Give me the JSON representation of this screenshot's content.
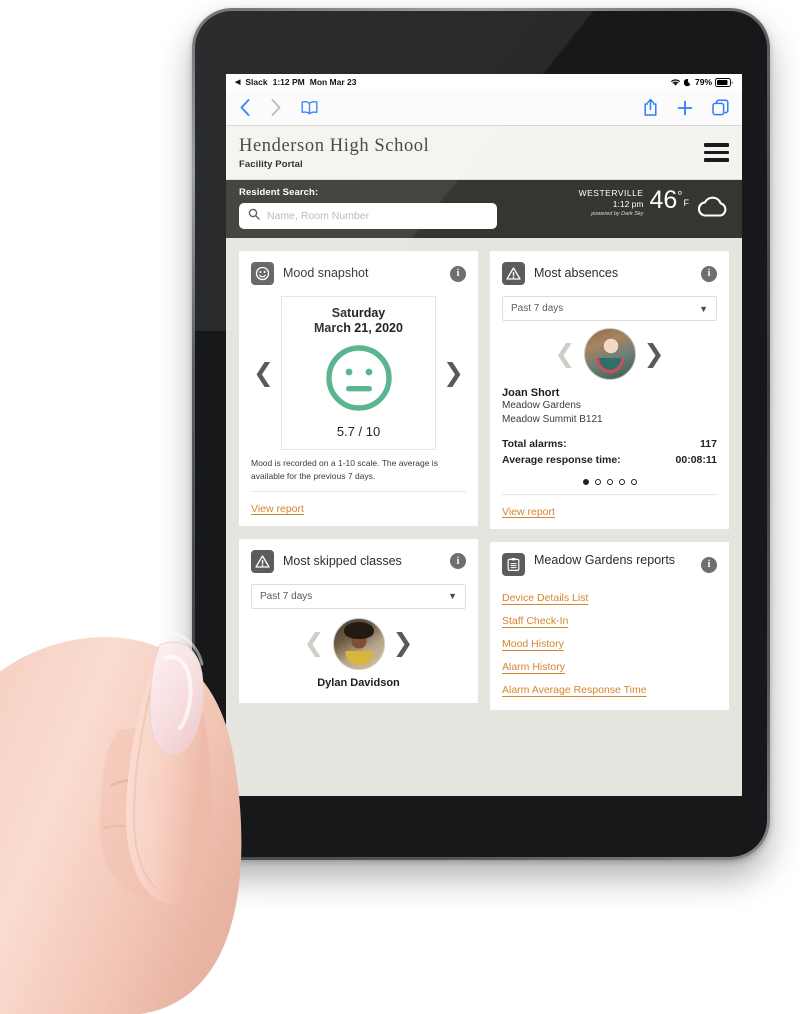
{
  "status_bar": {
    "back_app": "Slack",
    "time": "1:12 PM",
    "date": "Mon Mar 23",
    "battery": "79%",
    "wifi_icon": "wifi-icon",
    "dnd_icon": "crescent-moon-icon",
    "battery_icon": "battery-icon"
  },
  "browser_toolbar": {
    "back_icon": "chevron-left-icon",
    "forward_icon": "chevron-right-icon",
    "bookmarks_icon": "book-icon",
    "share_icon": "share-icon",
    "new_tab_icon": "plus-icon",
    "tabs_icon": "tabs-icon"
  },
  "app_header": {
    "school_name": "Henderson High School",
    "subtitle": "Facility Portal",
    "menu_icon": "hamburger-menu-icon"
  },
  "search": {
    "label": "Resident Search:",
    "placeholder": "Name, Room Number",
    "value": "",
    "icon": "search-icon"
  },
  "weather": {
    "city": "WESTERVILLE",
    "time": "1:12 pm",
    "powered_by": "powered by Dark Sky",
    "temperature": "46",
    "degree_symbol": "°",
    "unit": "F",
    "condition_icon": "cloud-icon"
  },
  "cards": {
    "mood": {
      "title": "Mood snapshot",
      "icon": "smiley-face-icon",
      "info_icon": "info-icon",
      "prev_icon": "chevron-left-icon",
      "next_icon": "chevron-right-icon",
      "day": "Saturday",
      "date": "March 21, 2020",
      "face_icon": "neutral-face-icon",
      "score": "5.7 / 10",
      "note": "Mood is recorded on a 1-10 scale. The average is available for the previous 7 days.",
      "view_report": "View report",
      "accent_color": "#5bb68f"
    },
    "absences": {
      "title": "Most absences",
      "icon": "warning-triangle-icon",
      "info_icon": "info-icon",
      "range_value": "Past 7 days",
      "range_caret": "chevron-down-icon",
      "prev_icon": "chevron-left-icon",
      "next_icon": "chevron-right-icon",
      "person_name": "Joan Short",
      "person_location_1": "Meadow Gardens",
      "person_location_2": "Meadow Summit B121",
      "stats": [
        {
          "label": "Total alarms:",
          "value": "117"
        },
        {
          "label": "Average response time:",
          "value": "00:08:11"
        }
      ],
      "dots_total": 5,
      "dots_active": 1,
      "view_report": "View report"
    },
    "skipped": {
      "title": "Most skipped classes",
      "icon": "warning-triangle-icon",
      "info_icon": "info-icon",
      "range_value": "Past 7 days",
      "range_caret": "chevron-down-icon",
      "prev_icon": "chevron-left-icon",
      "next_icon": "chevron-right-icon",
      "person_name": "Dylan Davidson"
    },
    "reports": {
      "title": "Meadow Gardens reports",
      "icon": "clipboard-icon",
      "info_icon": "info-icon",
      "links": [
        "Device Details List",
        "Staff Check-In",
        "Mood History",
        "Alarm History",
        "Alarm Average Response Time"
      ]
    }
  },
  "colors": {
    "link_orange": "#d4862f",
    "mood_green": "#5bb68f",
    "dark_bar": "#36352f",
    "page_bg": "#e5e4de",
    "ios_blue": "#2f7cf6"
  }
}
